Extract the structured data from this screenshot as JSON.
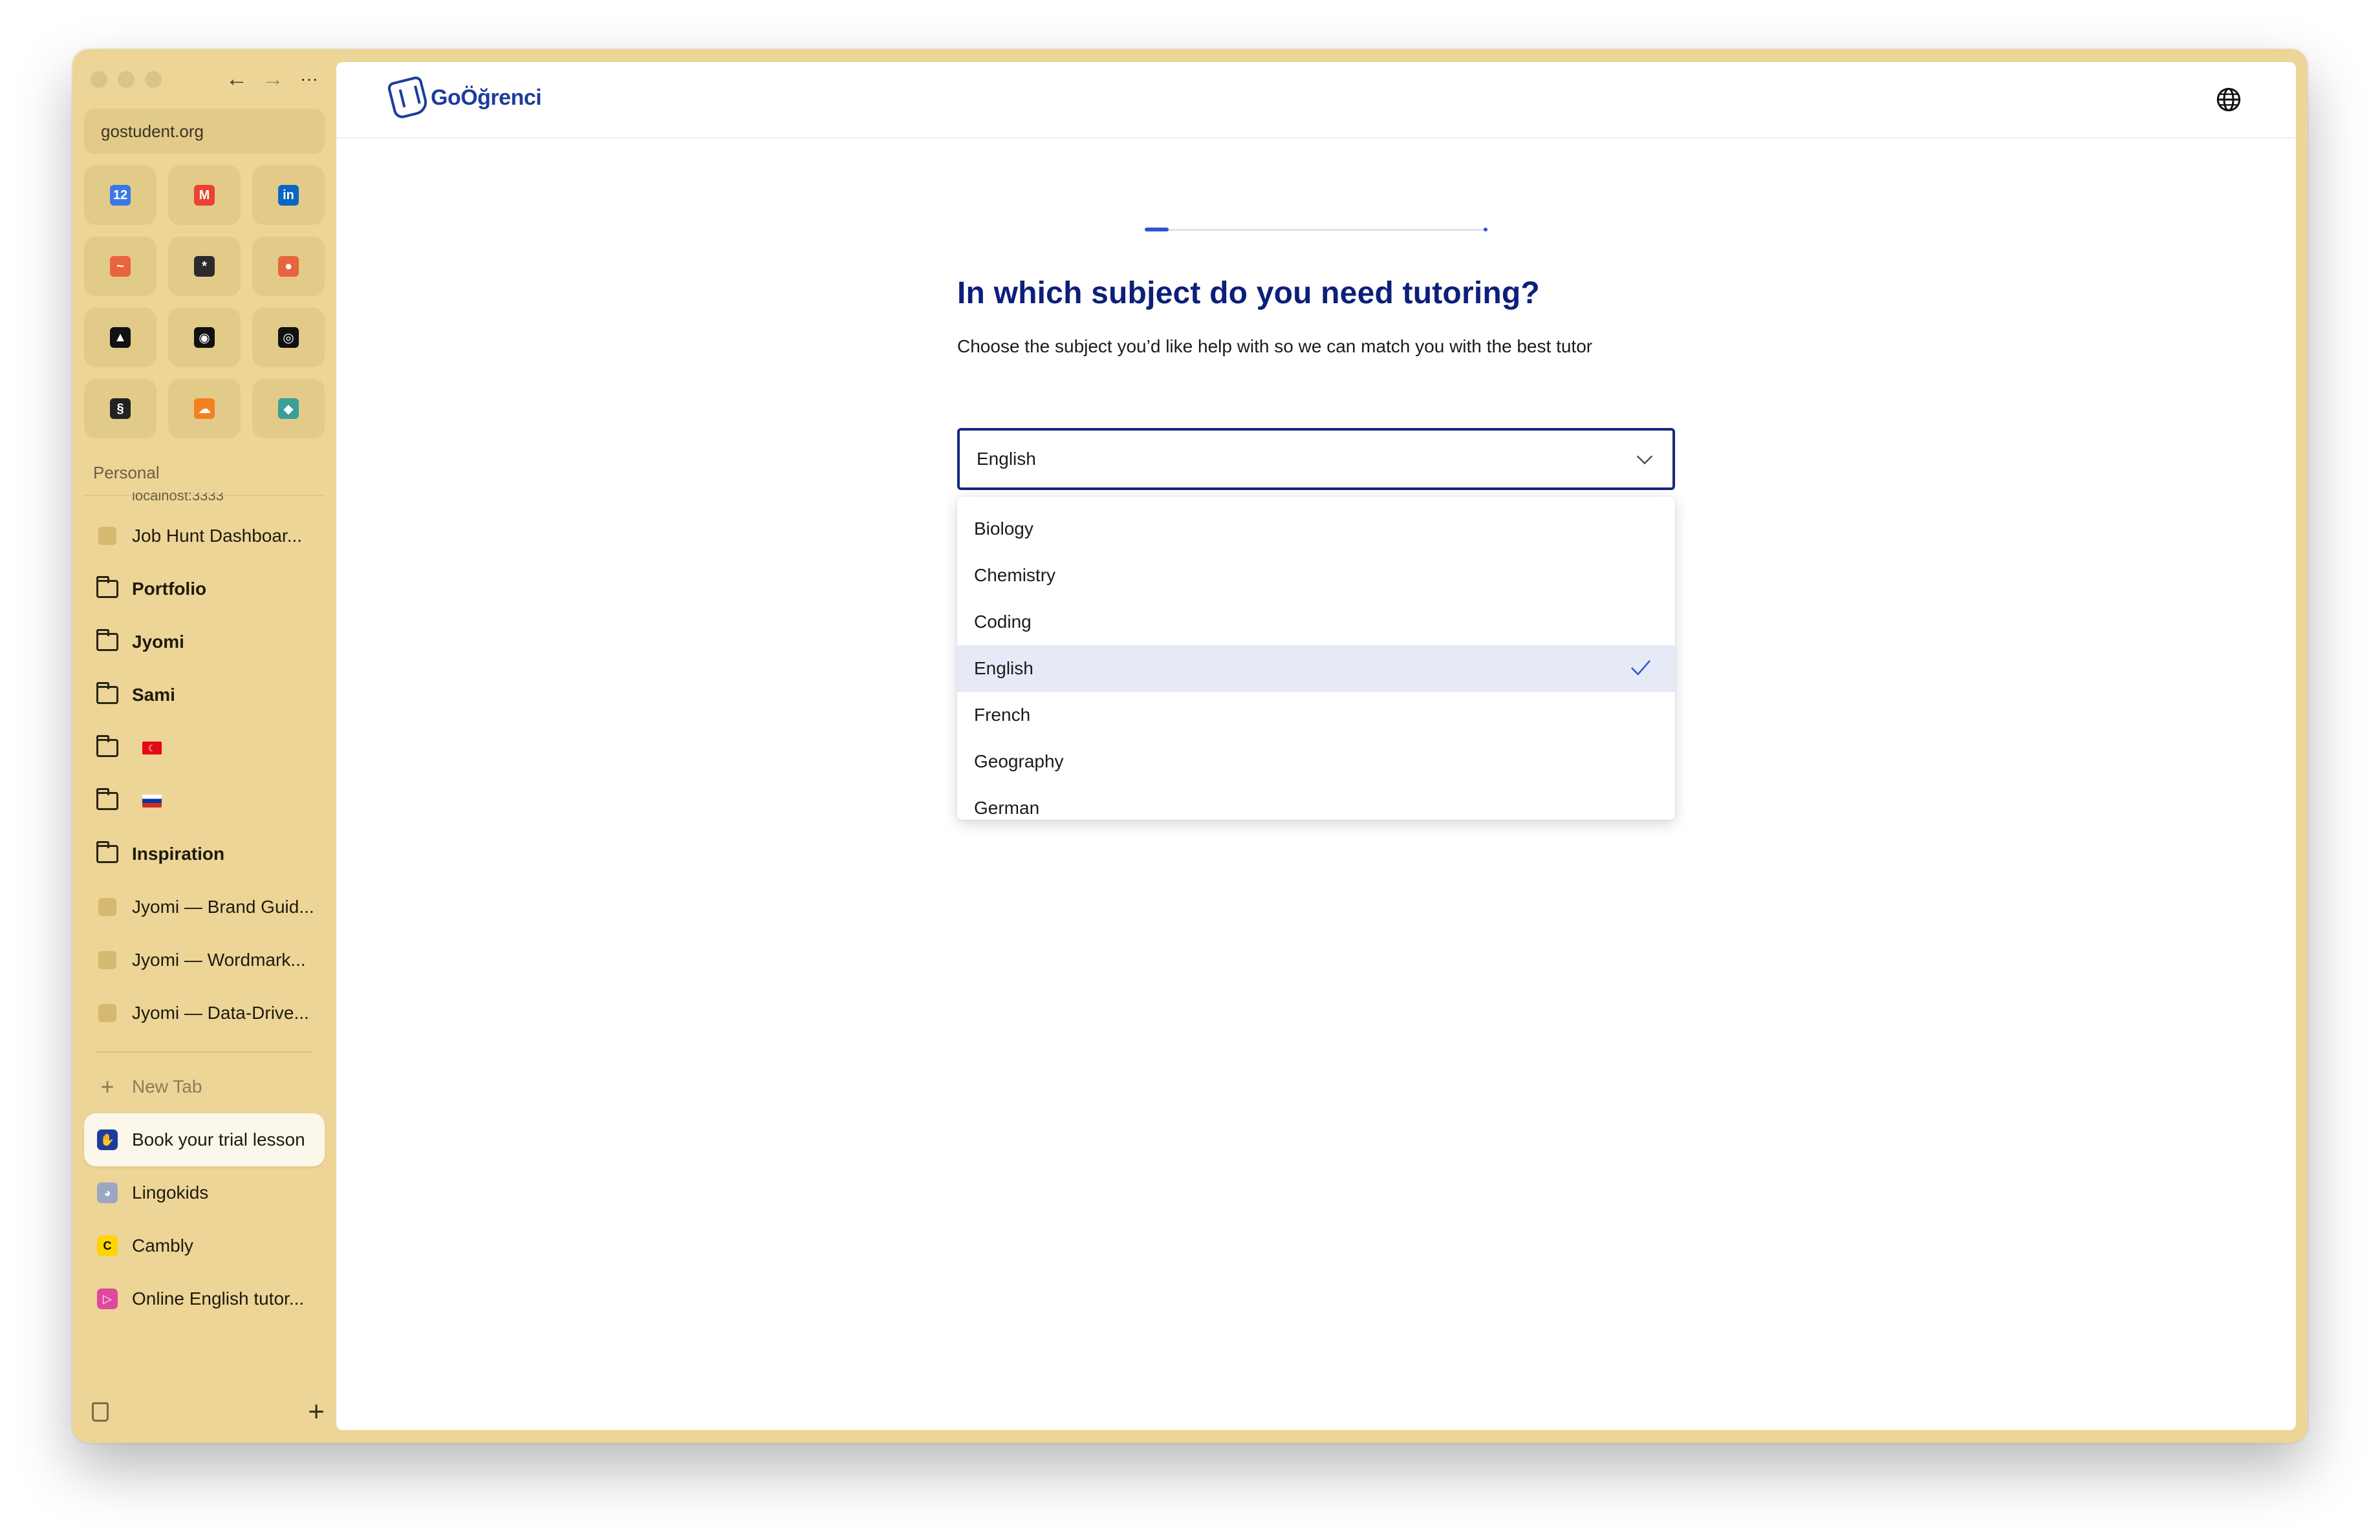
{
  "browser": {
    "url": "gostudent.org",
    "back_icon": "arrow-left-icon",
    "forward_icon": "arrow-right-icon",
    "more_icon": "ellipsis-icon",
    "favorites": [
      {
        "name": "calendar",
        "icon": "calendar-icon",
        "glyph": "12",
        "color": "#3b78e7"
      },
      {
        "name": "gmail",
        "icon": "gmail-icon",
        "glyph": "M",
        "color": "#ea4335"
      },
      {
        "name": "linkedin",
        "icon": "linkedin-icon",
        "glyph": "in",
        "color": "#0a66c2"
      },
      {
        "name": "analytics",
        "icon": "chart-line-icon",
        "glyph": "~",
        "color": "#e8643c"
      },
      {
        "name": "claude",
        "icon": "sparkle-icon",
        "glyph": "*",
        "color": "#2b2b2b"
      },
      {
        "name": "app-orange",
        "icon": "orange-circle-icon",
        "glyph": "●",
        "color": "#e8643c"
      },
      {
        "name": "vercel",
        "icon": "triangle-icon",
        "glyph": "▲",
        "color": "#111111"
      },
      {
        "name": "app-dark",
        "icon": "dark-circle-icon",
        "glyph": "◉",
        "color": "#111111"
      },
      {
        "name": "github",
        "icon": "github-icon",
        "glyph": "◎",
        "color": "#111111"
      },
      {
        "name": "squarespace",
        "icon": "squarespace-icon",
        "glyph": "§",
        "color": "#222222"
      },
      {
        "name": "cloudflare",
        "icon": "cloud-icon",
        "glyph": "☁",
        "color": "#f38020"
      },
      {
        "name": "app-diamond",
        "icon": "diamond-icon",
        "glyph": "◆",
        "color": "#3a9e9a"
      }
    ],
    "section_label": "Personal",
    "cut_text": "localhost:3333",
    "tabs": [
      {
        "label": "Job Hunt Dashboar...",
        "type": "page"
      },
      {
        "label": "Portfolio",
        "type": "folder"
      },
      {
        "label": "Jyomi",
        "type": "folder"
      },
      {
        "label": "Sami",
        "type": "folder"
      },
      {
        "label": "",
        "type": "folder-flag-tr"
      },
      {
        "label": "",
        "type": "folder-flag-ru"
      },
      {
        "label": "Inspiration",
        "type": "folder"
      },
      {
        "label": "Jyomi — Brand Guid...",
        "type": "page"
      },
      {
        "label": "Jyomi — Wordmark...",
        "type": "page"
      },
      {
        "label": "Jyomi — Data-Drive...",
        "type": "page"
      }
    ],
    "new_tab_label": "New Tab",
    "open_tabs": [
      {
        "label": "Book your trial lesson",
        "icon": "gostudent-icon",
        "color": "#1d3c9c",
        "active": true
      },
      {
        "label": "Lingokids",
        "icon": "lingokids-icon",
        "color": "#9aa6c2",
        "active": false
      },
      {
        "label": "Cambly",
        "icon": "cambly-icon",
        "color": "#ffd400",
        "active": false
      },
      {
        "label": "Online English tutor...",
        "icon": "play-icon",
        "color": "#e0479e",
        "active": false
      }
    ]
  },
  "page": {
    "logo_text": "GoÖğrenci",
    "progress_fraction": 0.07,
    "question": "In which subject do you need tutoring?",
    "subtitle": "Choose the subject you’d like help with so we can match you with the best tutor",
    "select": {
      "value": "English",
      "options": [
        "Biology",
        "Chemistry",
        "Coding",
        "English",
        "French",
        "Geography",
        "German"
      ],
      "selected_index": 3
    },
    "colors": {
      "brand": "#0c1f7a",
      "accent": "#2f55d4",
      "selected_bg": "#e5eaf6"
    }
  }
}
